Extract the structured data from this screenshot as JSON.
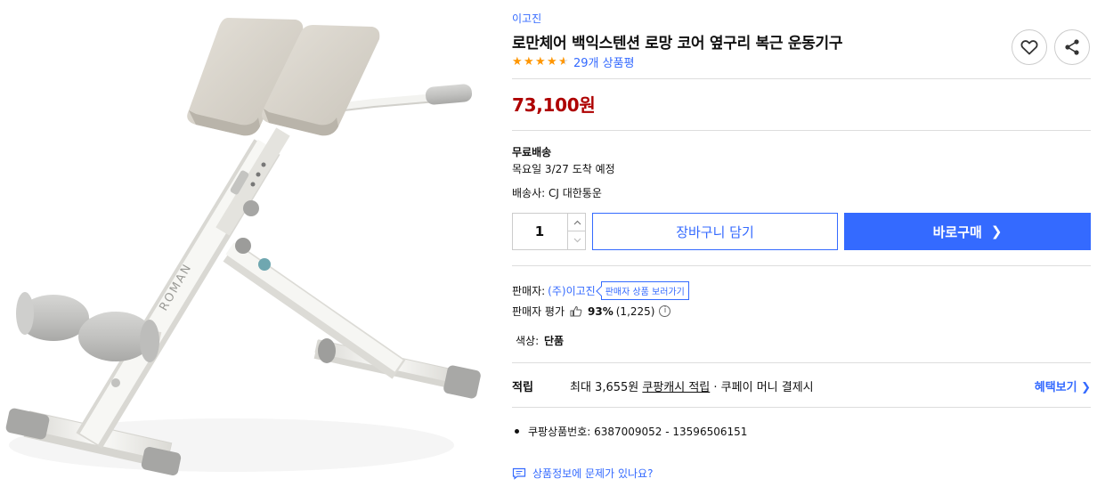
{
  "product": {
    "brand": "이고진",
    "title": "로만체어 백익스텐션 로망 코어 옆구리 복근 운동기구",
    "rating": 4.5,
    "review_count": "29개 상품평",
    "price": "73,100원",
    "image_label": "ROMAN"
  },
  "actions": {
    "wish_icon": "heart-icon",
    "share_icon": "share-icon"
  },
  "shipping": {
    "title": "무료배송",
    "date": "목요일 3/27 도착 예정",
    "carrier": "배송사: CJ 대한통운"
  },
  "purchase": {
    "quantity": "1",
    "cart_label": "장바구니 담기",
    "buy_label": "바로구매",
    "buy_chevron": "❯"
  },
  "seller": {
    "label": "판매자:",
    "name": "(주)이고진",
    "link_label": "판매자 상품 보러가기",
    "eval_label": "판매자 평가",
    "eval_score": "93%",
    "eval_count": "(1,225)",
    "info_glyph": "i"
  },
  "option": {
    "label": "색상:",
    "value": "단품"
  },
  "points": {
    "label": "적립",
    "prefix": "최대 3,655원 ",
    "link": "쿠팡캐시 적립",
    "suffix": " · 쿠페이 머니 결제시",
    "benefit_label": "혜택보기 ❯"
  },
  "sku": {
    "text": "쿠팡상품번호: 6387009052 - 13596506151"
  },
  "report": {
    "text": "상품정보에 문제가 있나요?"
  },
  "colors": {
    "accent": "#346aff",
    "price": "#ae0000",
    "star": "#ff9600",
    "frame": "#f1f0ec",
    "pad": "#d8d3ca"
  }
}
